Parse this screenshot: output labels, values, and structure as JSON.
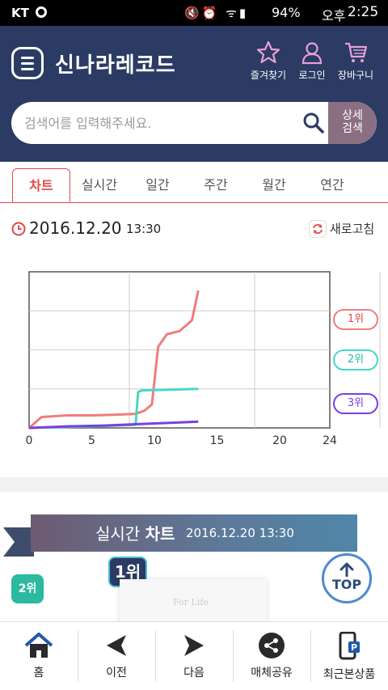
{
  "status_bar": {
    "carrier": "KT",
    "battery": "94%",
    "ampm": "오후",
    "time": "2:25"
  },
  "header": {
    "logo": "신나라레코드",
    "favorites_label": "즐겨찾기",
    "login_label": "로그인",
    "cart_label": "장바구니",
    "search_placeholder": "검색어를 입력해주세요.",
    "advanced_search_line1": "상세",
    "advanced_search_line2": "검색"
  },
  "tabs": [
    {
      "label": "차트",
      "active": true
    },
    {
      "label": "실시간",
      "active": false
    },
    {
      "label": "일간",
      "active": false
    },
    {
      "label": "주간",
      "active": false
    },
    {
      "label": "월간",
      "active": false
    },
    {
      "label": "연간",
      "active": false
    }
  ],
  "chart_header": {
    "date": "2016.12.20",
    "time": "13:30",
    "refresh_label": "새로고침"
  },
  "chart_data": {
    "type": "line",
    "x_ticks": [
      0,
      5,
      10,
      15,
      20,
      24
    ],
    "xlim": [
      0,
      24
    ],
    "ylim": [
      0,
      100
    ],
    "grid": true,
    "legend_placement": "right",
    "series": [
      {
        "name": "1위",
        "color": "#f07c7c",
        "x": [
          0,
          1,
          3,
          5,
          7,
          8.5,
          9.2,
          9.8,
          10.3,
          11,
          12,
          13,
          13.5
        ],
        "y": [
          0,
          7,
          8,
          8,
          8.5,
          9,
          11,
          15,
          52,
          60,
          62,
          69,
          88
        ]
      },
      {
        "name": "2위",
        "color": "#49d7c6",
        "x": [
          0,
          5,
          8.5,
          8.7,
          9,
          13.5
        ],
        "y": [
          0,
          1,
          2,
          23,
          24,
          25
        ]
      },
      {
        "name": "3위",
        "color": "#7b3fe0",
        "x": [
          0,
          3,
          6,
          9,
          12,
          13.5
        ],
        "y": [
          0,
          1,
          1.5,
          2.5,
          3.5,
          4
        ]
      }
    ]
  },
  "banner": {
    "title_plain": "실시간",
    "title_bold": "차트",
    "date": "2016.12.20 13:30",
    "rank1": "1위",
    "rank2": "2위",
    "card_text": "For Life",
    "top_label": "TOP"
  },
  "bottom_nav": [
    {
      "label": "홈",
      "icon": "home-icon"
    },
    {
      "label": "이전",
      "icon": "back-arrow-icon"
    },
    {
      "label": "다음",
      "icon": "forward-arrow-icon"
    },
    {
      "label": "매체공유",
      "icon": "share-icon"
    },
    {
      "label": "최근본상품",
      "icon": "recent-items-icon"
    }
  ]
}
